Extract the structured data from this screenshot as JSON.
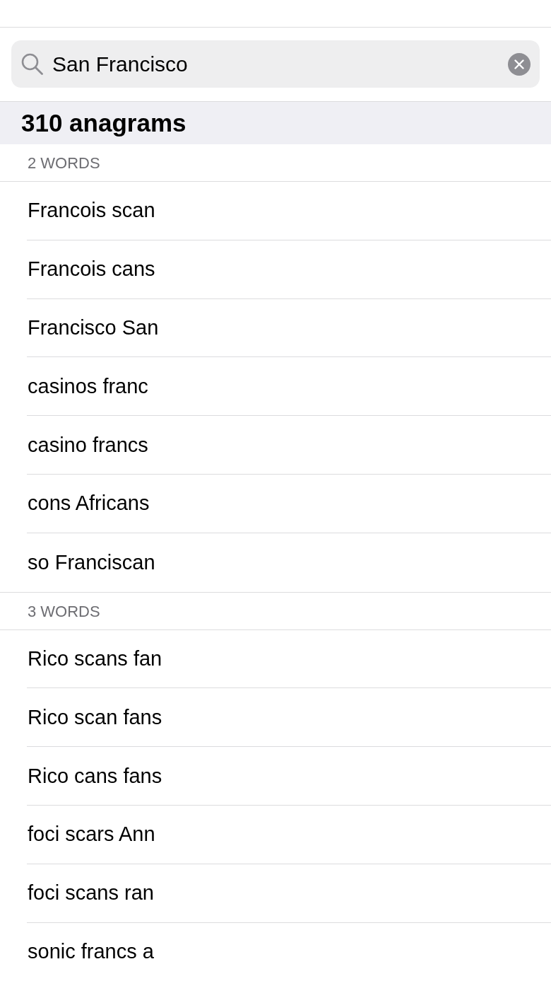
{
  "search": {
    "value": "San Francisco"
  },
  "results": {
    "title": "310 anagrams",
    "sections": [
      {
        "header": "2 WORDS",
        "items": [
          "Francois scan",
          "Francois cans",
          "Francisco San",
          "casinos franc",
          "casino francs",
          "cons Africans",
          "so Franciscan"
        ]
      },
      {
        "header": "3 WORDS",
        "items": [
          "Rico scans fan",
          "Rico scan fans",
          "Rico cans fans",
          "foci scars Ann",
          "foci scans ran",
          "sonic francs a"
        ]
      }
    ]
  }
}
